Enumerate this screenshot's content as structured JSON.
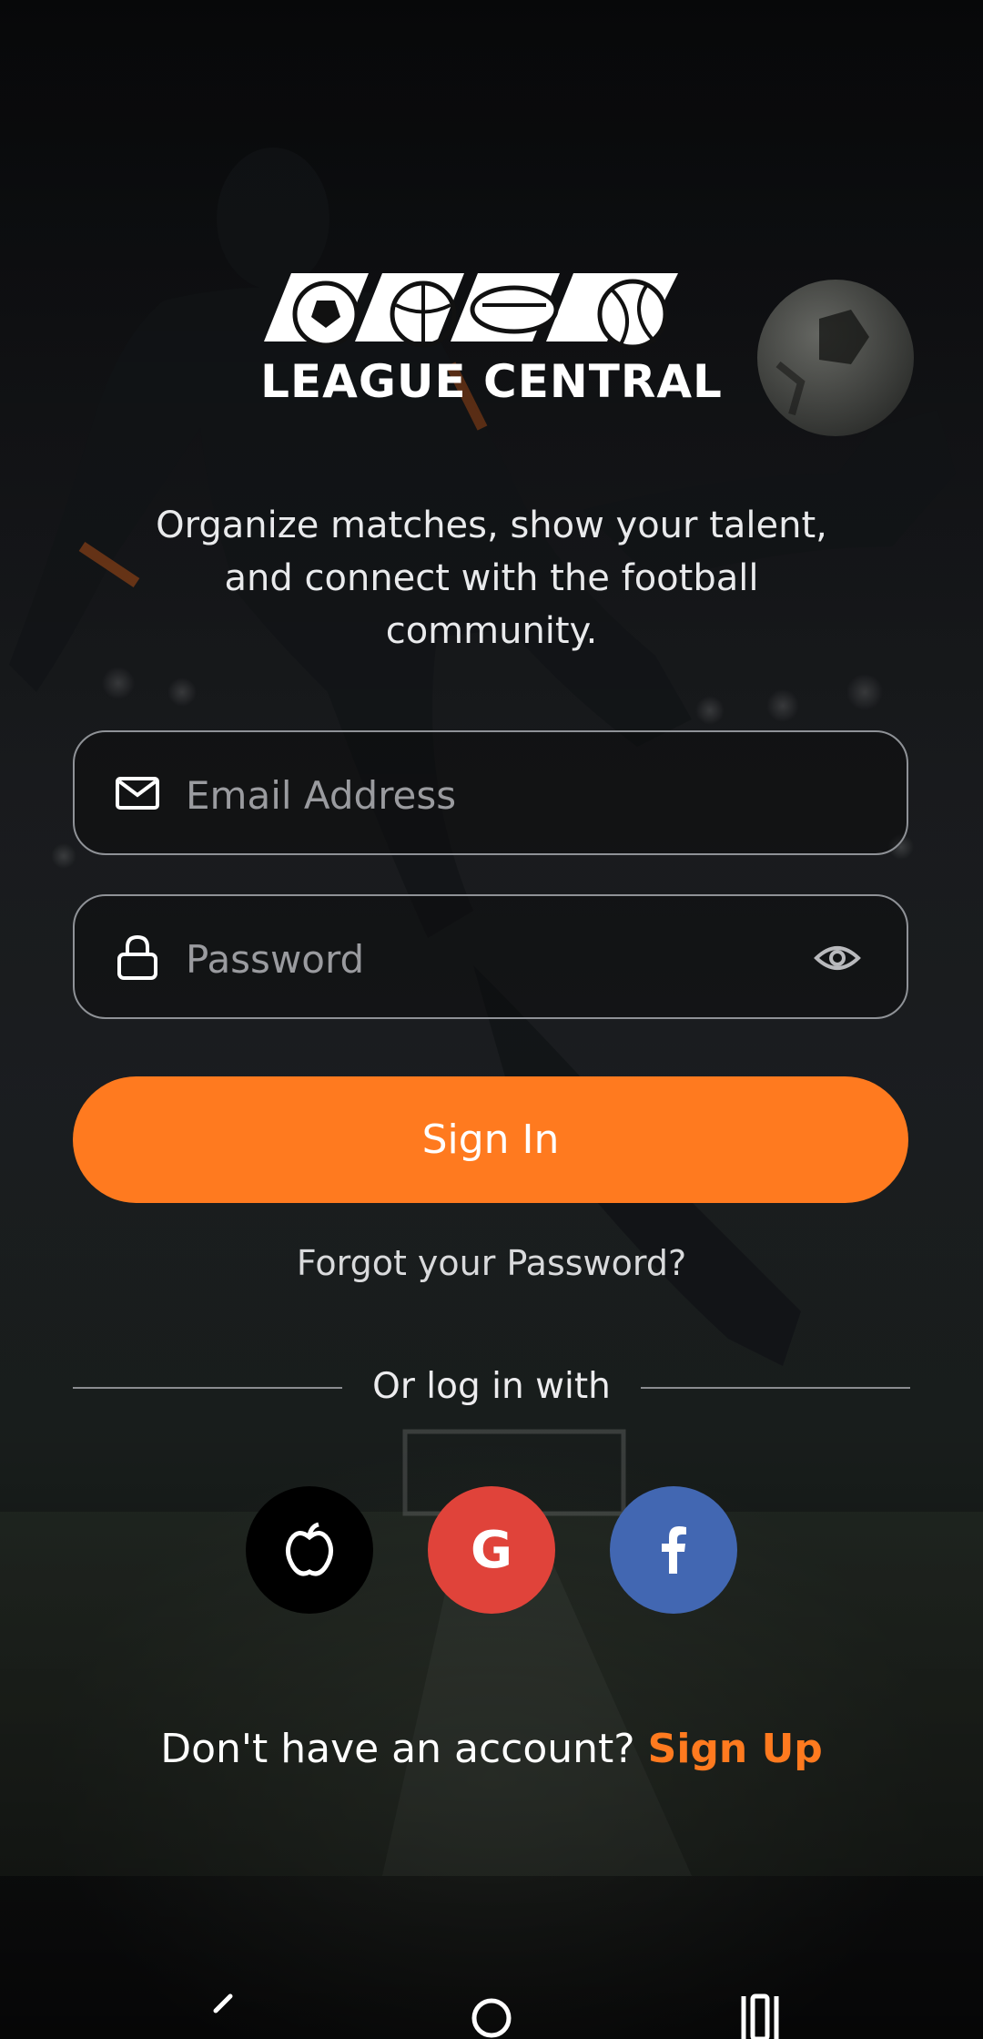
{
  "brand": {
    "name": "LEAGUE CENTRAL",
    "tagline": "Organize matches, show your talent, and connect with the football community."
  },
  "form": {
    "email_placeholder": "Email Address",
    "password_placeholder": "Password",
    "sign_in_label": "Sign In",
    "forgot_label": "Forgot your Password?"
  },
  "social": {
    "divider_label": "Or log in with",
    "google_letter": "G",
    "buttons": [
      {
        "name": "apple",
        "color": "#000000",
        "icon": "apple-icon"
      },
      {
        "name": "google",
        "color": "#e0433a",
        "icon": "google-g-icon"
      },
      {
        "name": "facebook",
        "color": "#4267b2",
        "icon": "facebook-icon"
      }
    ]
  },
  "signup": {
    "prompt": "Don't have an account?",
    "link_label": "Sign Up"
  },
  "colors": {
    "accent": "#ff7a1f",
    "background": "#121316",
    "field_border": "#8f9297"
  }
}
